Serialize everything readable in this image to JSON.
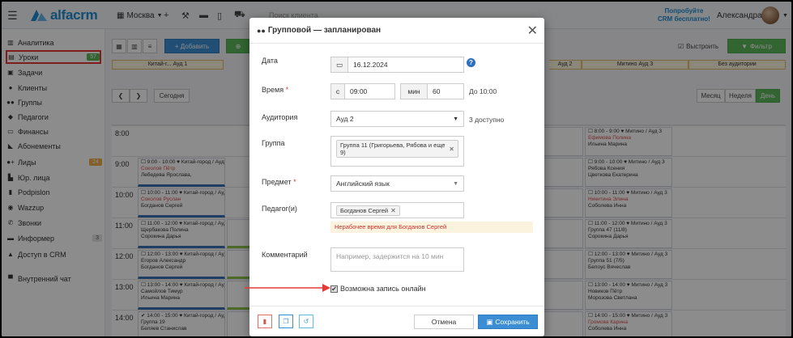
{
  "topbar": {
    "logo": "alfacrm",
    "city": "Москва",
    "search_placeholder": "Поиск клиента",
    "promo_line1": "Попробуйте",
    "promo_line2": "CRM бесплатно!",
    "user": "Александра"
  },
  "sidebar": {
    "items": [
      {
        "label": "Аналитика",
        "icon": "chart-icon"
      },
      {
        "label": "Уроки",
        "icon": "calendar-icon",
        "badge": "57",
        "active": true
      },
      {
        "label": "Задачи",
        "icon": "tasks-icon"
      },
      {
        "label": "Клиенты",
        "icon": "user-icon"
      },
      {
        "label": "Группы",
        "icon": "group-icon"
      },
      {
        "label": "Педагоги",
        "icon": "graduation-icon"
      },
      {
        "label": "Финансы",
        "icon": "money-icon"
      },
      {
        "label": "Абонементы",
        "icon": "tag-icon"
      },
      {
        "label": "Лиды",
        "icon": "leads-icon",
        "badge": "24"
      },
      {
        "label": "Юр. лица",
        "icon": "building-icon"
      },
      {
        "label": "Podpislon",
        "icon": "doc-icon"
      },
      {
        "label": "Wazzup",
        "icon": "chat-icon"
      },
      {
        "label": "Звонки",
        "icon": "phone-icon"
      },
      {
        "label": "Информер",
        "icon": "informer-icon",
        "badge": "3"
      },
      {
        "label": "Доступ в CRM",
        "icon": "lock-icon"
      },
      {
        "label": "Внутренний чат",
        "icon": "message-icon"
      }
    ]
  },
  "main": {
    "add_label": "+ Добавить",
    "out_label": "Выстроить",
    "filter_label": "Фильтр",
    "rooms": [
      "Китай-г... Ауд 1",
      "Ауд 2",
      "Митино Ауд 3",
      "Без аудитории"
    ],
    "today_label": "Сегодня",
    "views": [
      "Месяц",
      "Неделя",
      "День"
    ],
    "hours": [
      "8:00",
      "9:00",
      "10:00",
      "11:00",
      "12:00",
      "13:00",
      "14:00"
    ],
    "events_left": [
      {
        "l1": "☐ 9:00 - 10:00 ♥ Китай-город / Ауд 1",
        "l2": "Соколов Пётр",
        "l3": "Лебедева Ярослава,"
      },
      {
        "l1": "☐ 10:00 - 11:00 ♥ Китай-город / Ауд 1",
        "l2": "Соколов Руслан",
        "l3": "Богданов Сергей"
      },
      {
        "l1": "☐ 11:00 - 12:00 ♥ Китай-город / Ауд 1",
        "l2": "Щербакова Полина",
        "l3": "Сорокина Дарья"
      },
      {
        "l1": "☐ 12:00 - 13:00 ♥ Китай-город / Ауд 1",
        "l2": "Егоров Александр",
        "l3": "Богданов Сергей"
      },
      {
        "l1": "☐ 13:00 - 14:00 ♥ Китай-город / Ауд 1",
        "l2": "Самойлов Тимур",
        "l3": "Ильина Марина"
      },
      {
        "l1": "✔ 14:00 - 15:00 ♥ Китай-город / Ауд 1",
        "l2": "Группа 19",
        "l3": "Беляев Станислав"
      }
    ],
    "events_right": [
      {
        "l1": "☐ 8:00 - 9:00 ♥ Митино / Ауд 3",
        "l2": "Ефимова Полина",
        "l3": "Ильина Марина"
      },
      {
        "l1": "☐ 9:00 - 10:00 ♥ Митино / Ауд 3",
        "l2": "Рябова Ксения",
        "l3": "Цветкова Екатерина"
      },
      {
        "l1": "☐ 10:00 - 11:00 ♥ Митино / Ауд 3",
        "l2": "Никитина Элина",
        "l3": "Соболева Инна"
      },
      {
        "l1": "☐ 11:00 - 12:00 ♥ Митино / Ауд 3",
        "l2": "Группа 47 (11/8)",
        "l3": "Сорокина Дарья"
      },
      {
        "l1": "☐ 12:00 - 13:00 ♥ Митино / Ауд 3",
        "l2": "Группа 51 (7/5)",
        "l3": "Белоус Вячеслав"
      },
      {
        "l1": "☐ 13:00 - 14:00 ♥ Митино / Ауд 3",
        "l2": "Новиков Пётр",
        "l3": "Морозова Светлана"
      },
      {
        "l1": "☐ 14:00 - 15:00 ♥ Митино / Ауд 3",
        "l2": "Громова Карина",
        "l3": "Соболева Инна"
      }
    ]
  },
  "modal": {
    "title": "Групповой — запланирован",
    "date_label": "Дата",
    "date_value": "16.12.2024",
    "time_label": "Время",
    "time_prefix": "с",
    "time_start": "09:00",
    "duration_prefix": "мин",
    "duration": "60",
    "time_end": "До 10:00",
    "room_label": "Аудитория",
    "room_value": "Ауд 2",
    "room_available": "3 доступно",
    "group_label": "Группа",
    "group_tag": "Группа 11 (Григорьева, Рябова и еще 9)",
    "subject_label": "Предмет",
    "subject_value": "Английский язык",
    "teacher_label": "Педагог(и)",
    "teacher_tag": "Богданов Сергей",
    "warning": "Нерабочее время для Богданов Сергей",
    "comment_label": "Комментарий",
    "comment_placeholder": "Например, задержится на 10 мин",
    "online_label": "Возможна запись онлайн",
    "cancel": "Отмена",
    "save": "Сохранить",
    "required_mark": "*"
  }
}
